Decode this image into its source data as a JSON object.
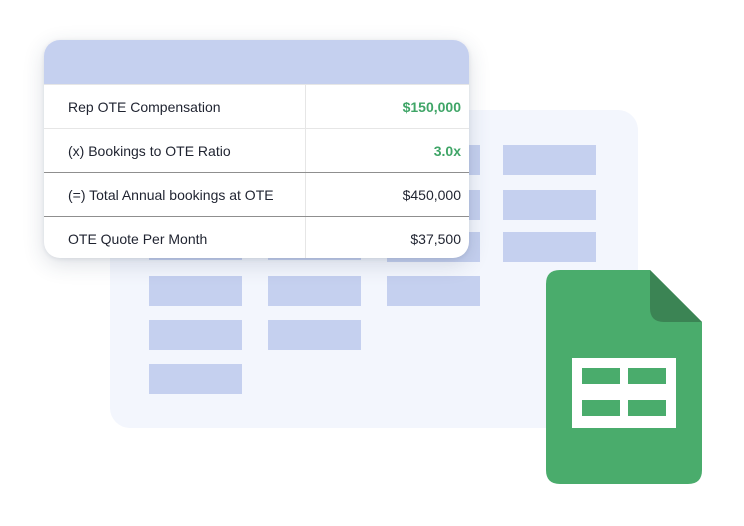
{
  "table": {
    "rows": [
      {
        "label": "Rep OTE Compensation",
        "value": "$150,000",
        "highlight": true
      },
      {
        "label": "(x) Bookings to OTE Ratio",
        "value": "3.0x",
        "highlight": true
      },
      {
        "label": "(=) Total Annual bookings at OTE",
        "value": "$450,000",
        "highlight": false
      },
      {
        "label": "OTE Quote Per Month",
        "value": "$37,500",
        "highlight": false
      }
    ]
  },
  "icons": {
    "spreadsheet": "spreadsheet-icon"
  },
  "colors": {
    "header": "#c5d0ef",
    "accent_green": "#3fa567",
    "sheet_green": "#4aac6c",
    "sheet_fold": "#3b8454",
    "background_sheet": "#f3f6fd"
  }
}
